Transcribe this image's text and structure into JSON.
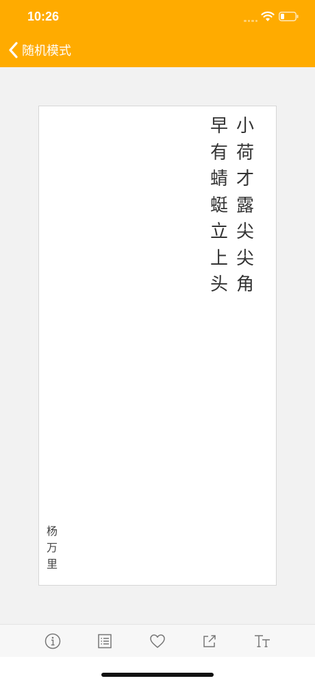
{
  "status_bar": {
    "time": "10:26"
  },
  "nav": {
    "title": "随机模式"
  },
  "poem": {
    "lines": [
      "小荷才露尖尖角",
      "早有蜻蜓立上头"
    ],
    "author": "杨万里"
  },
  "toolbar": {
    "icons": [
      "info-icon",
      "list-icon",
      "heart-icon",
      "share-icon",
      "text-size-icon"
    ]
  },
  "colors": {
    "accent": "#ffab00"
  }
}
